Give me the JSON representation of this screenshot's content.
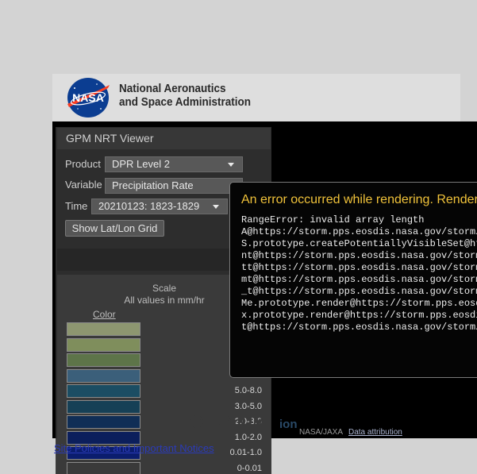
{
  "header": {
    "agency_line1": "National Aeronautics",
    "agency_line2": "and Space Administration",
    "logo_text": "NASA"
  },
  "panel": {
    "title": "GPM NRT Viewer",
    "product_label": "Product",
    "product_value": "DPR Level 2",
    "variable_label": "Variable",
    "variable_value": "Precipitation Rate",
    "time_label": "Time",
    "time_value": "20210123: 1823-1829",
    "latlon_button": "Show Lat/Lon Grid"
  },
  "scale": {
    "title": "Scale",
    "subtitle": "All values in mm/hr",
    "color_header": "Color",
    "entries": [
      {
        "range": "",
        "color": "#8d9670"
      },
      {
        "range": "2",
        "color": "#7f8e5c"
      },
      {
        "range": "1",
        "color": "#5d7449"
      },
      {
        "range": "",
        "color": "#3b5f7a"
      },
      {
        "range": "5.0-8.0",
        "color": "#1b4d63"
      },
      {
        "range": "3.0-5.0",
        "color": "#164056"
      },
      {
        "range": "2.0-3.0",
        "color": "#102e56"
      },
      {
        "range": "1.0-2.0",
        "color": "#0c1f5c"
      },
      {
        "range": "0.01-1.0",
        "color": "#0b1d6e"
      },
      {
        "range": "0-0.01",
        "color": "#3a3a3a"
      }
    ]
  },
  "footer": {
    "cesium": "CESIUM",
    "ion": "ion",
    "attribution": "NASA/JAXA",
    "attribution_link": "Data attribution",
    "notice_link": "Site Policies and Important Notices"
  },
  "error": {
    "title": "An error occurred while rendering. Rendering has stopped.",
    "message": "RangeError: invalid array length\nA@https://storm.pps.eosdis.nasa.gov/storm/cesium\nS.prototype.createPotentiallyVisibleSet@https\nnt@https://storm.pps.eosdis.nasa.gov/storm/cesium\ntt@https://storm.pps.eosdis.nasa.gov/storm/cesium\nmt@https://storm.pps.eosdis.nasa.gov/storm/cesium\n_t@https://storm.pps.eosdis.nasa.gov/storm/cesium\nMe.prototype.render@https://storm.pps.eosdis\nx.prototype.render@https://storm.pps.eosdis\nt@https://storm.pps.eosdis.nasa.gov/storm/cesium"
  }
}
